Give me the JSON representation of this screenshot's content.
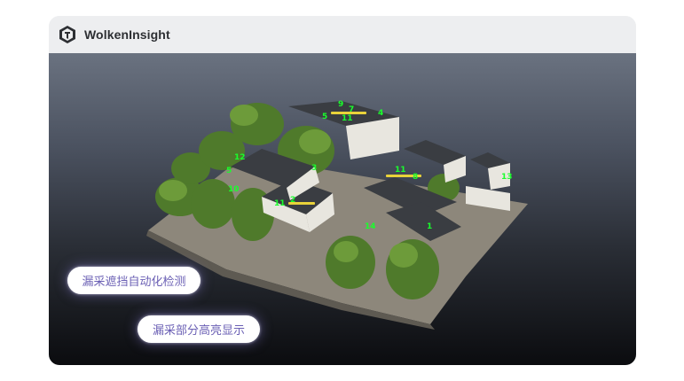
{
  "app": {
    "title": "WolkenInsight",
    "logo_icon": "cube-logo-icon"
  },
  "buttons": {
    "occlusion_detect": "漏采遮挡自动化检测",
    "highlight_missing": "漏采部分高亮显示"
  },
  "markers": [
    "9",
    "7",
    "4",
    "5",
    "11",
    "3",
    "12",
    "5",
    "10",
    "11",
    "2",
    "11",
    "8",
    "13",
    "14",
    "1"
  ],
  "colors": {
    "marker": "#19ff2c",
    "pill_text": "#6a5fb4",
    "titlebar": "#edeef0"
  }
}
